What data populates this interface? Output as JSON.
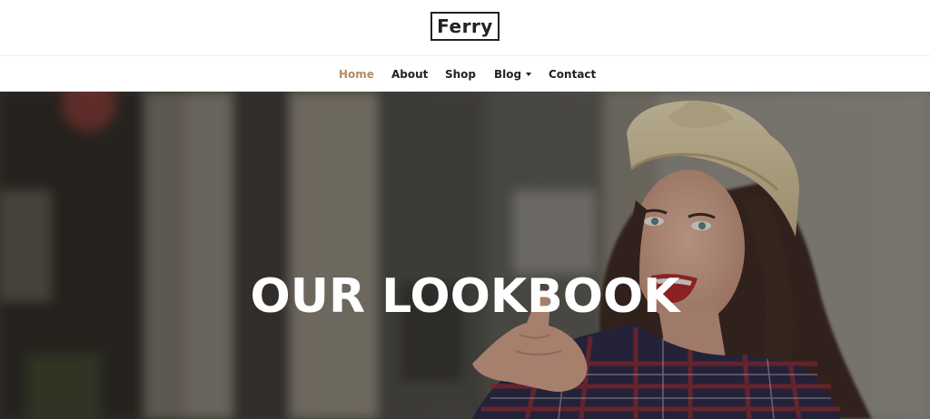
{
  "header": {
    "logo_text": "Ferry"
  },
  "nav": {
    "items": [
      {
        "label": "Home",
        "active": true
      },
      {
        "label": "About",
        "active": false
      },
      {
        "label": "Shop",
        "active": false
      },
      {
        "label": "Blog",
        "active": false,
        "has_dropdown": true
      },
      {
        "label": "Contact",
        "active": false
      }
    ]
  },
  "hero": {
    "title": "OUR LOOKBOOK"
  },
  "colors": {
    "accent": "#b58a63",
    "text": "#222222",
    "hero_text": "#ffffff"
  }
}
